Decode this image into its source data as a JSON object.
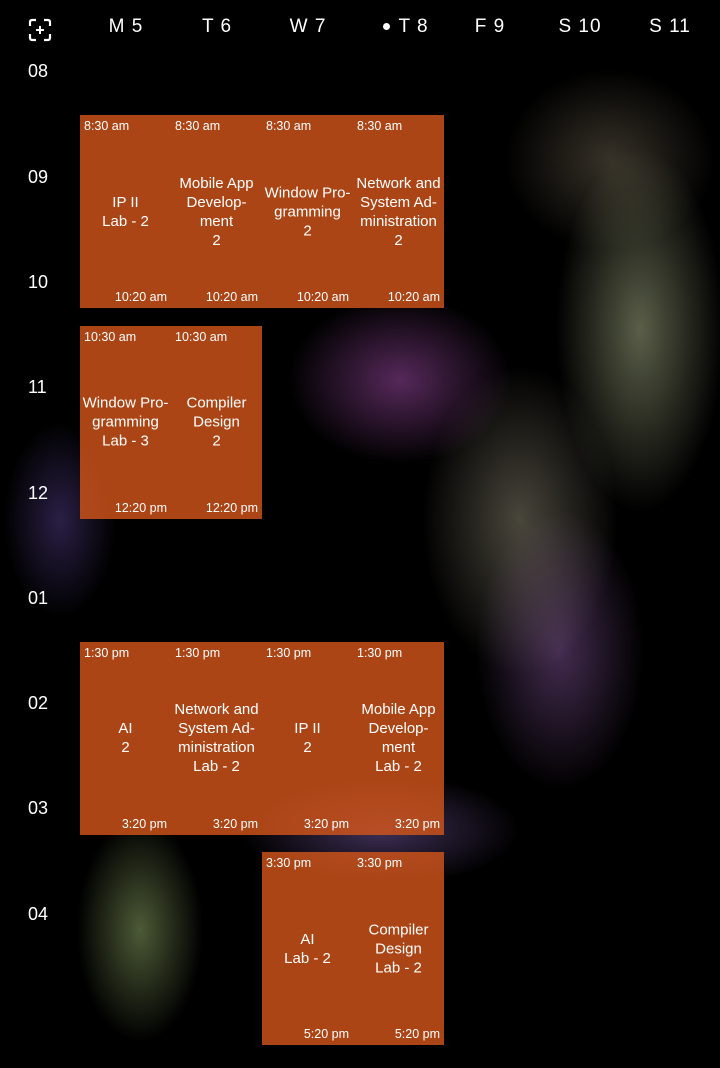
{
  "header": {
    "add_icon": "add-event-icon",
    "days": [
      {
        "label": "M 5",
        "today": false
      },
      {
        "label": "T 6",
        "today": false
      },
      {
        "label": "W 7",
        "today": false
      },
      {
        "label": "T 8",
        "today": true
      },
      {
        "label": "F 9",
        "today": false
      },
      {
        "label": "S 10",
        "today": false
      },
      {
        "label": "S 11",
        "today": false
      }
    ]
  },
  "hours": [
    "08",
    "09",
    "10",
    "11",
    "12",
    "01",
    "02",
    "03",
    "04"
  ],
  "accent": "#d2551a",
  "events": [
    {
      "day": 0,
      "start": "8:30 am",
      "end": "10:20 am",
      "title": "IP II\nLab - 2",
      "s": 510,
      "e": 620
    },
    {
      "day": 1,
      "start": "8:30 am",
      "end": "10:20 am",
      "title": "Mobile App\nDevelop-\nment\n2",
      "s": 510,
      "e": 620
    },
    {
      "day": 2,
      "start": "8:30 am",
      "end": "10:20 am",
      "title": "Window Pro-\ngramming\n2",
      "s": 510,
      "e": 620
    },
    {
      "day": 3,
      "start": "8:30 am",
      "end": "10:20 am",
      "title": "Network and\nSystem Ad-\nministration\n2",
      "s": 510,
      "e": 620
    },
    {
      "day": 0,
      "start": "10:30 am",
      "end": "12:20 pm",
      "title": "Window Pro-\ngramming\nLab - 3",
      "s": 630,
      "e": 740
    },
    {
      "day": 1,
      "start": "10:30 am",
      "end": "12:20 pm",
      "title": "Compiler\nDesign\n2",
      "s": 630,
      "e": 740
    },
    {
      "day": 0,
      "start": "1:30 pm",
      "end": "3:20 pm",
      "title": "AI\n2",
      "s": 810,
      "e": 920
    },
    {
      "day": 1,
      "start": "1:30 pm",
      "end": "3:20 pm",
      "title": "Network and\nSystem Ad-\nministration\nLab  - 2",
      "s": 810,
      "e": 920
    },
    {
      "day": 2,
      "start": "1:30 pm",
      "end": "3:20 pm",
      "title": "IP II\n2",
      "s": 810,
      "e": 920
    },
    {
      "day": 3,
      "start": "1:30 pm",
      "end": "3:20 pm",
      "title": "Mobile App\nDevelop-\nment\nLab - 2",
      "s": 810,
      "e": 920
    },
    {
      "day": 2,
      "start": "3:30 pm",
      "end": "5:20 pm",
      "title": "AI\nLab - 2",
      "s": 930,
      "e": 1040
    },
    {
      "day": 3,
      "start": "3:30 pm",
      "end": "5:20 pm",
      "title": "Compiler\nDesign\nLab - 2",
      "s": 930,
      "e": 1040
    }
  ]
}
